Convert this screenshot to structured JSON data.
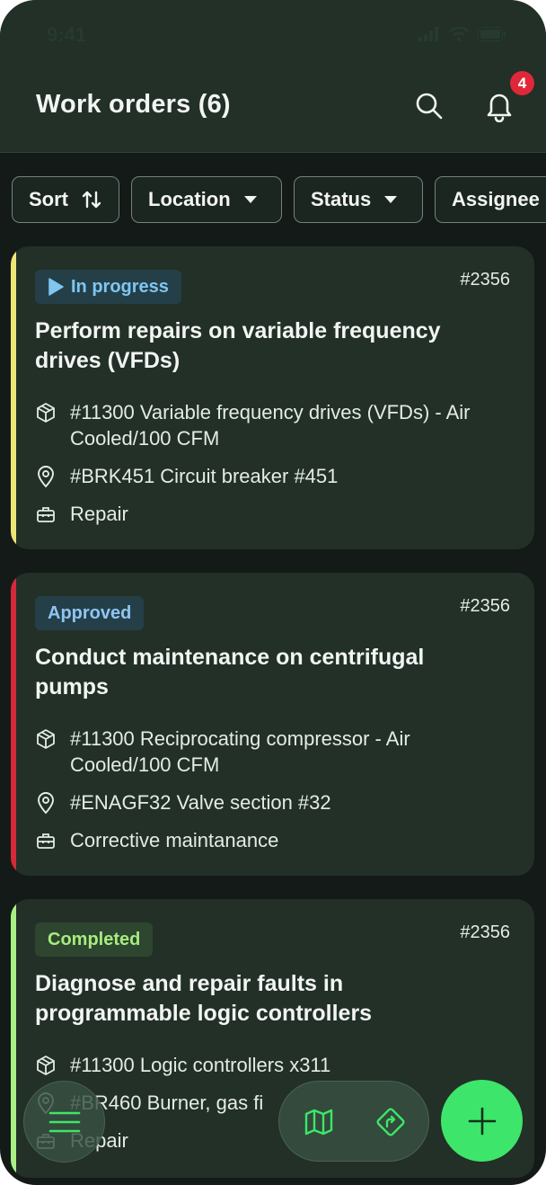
{
  "status_bar": {
    "time": "9:41"
  },
  "header": {
    "title": "Work orders (6)",
    "notification_count": "4"
  },
  "filters": [
    {
      "label": "Sort",
      "icon": "sort-arrows-icon"
    },
    {
      "label": "Location",
      "icon": "caret-down-icon"
    },
    {
      "label": "Status",
      "icon": "caret-down-icon"
    },
    {
      "label": "Assignee",
      "icon": "caret-down-icon"
    }
  ],
  "orders": [
    {
      "status": "In progress",
      "status_color": "#7fc6f0",
      "status_bg": "#253f49",
      "accent": "#eee577",
      "number": "#2356",
      "title": "Perform repairs on variable frequency drives (VFDs)",
      "asset": "#11300 Variable frequency drives (VFDs) - Air Cooled/100 CFM",
      "location": "#BRK451 Circuit breaker #451",
      "type": "Repair"
    },
    {
      "status": "Approved",
      "status_color": "#8fc5f2",
      "status_bg": "#253f49",
      "accent": "#d42a3a",
      "number": "#2356",
      "title": "Conduct maintenance on centrifugal pumps",
      "asset": "#11300 Reciprocating compressor - Air Cooled/100 CFM",
      "location": "#ENAGF32 Valve section #32",
      "type": "Corrective maintanance"
    },
    {
      "status": "Completed",
      "status_color": "#a6ec7e",
      "status_bg": "#2e4530",
      "accent": "#a9f084",
      "number": "#2356",
      "title": "Diagnose and repair faults in programmable logic controllers",
      "asset": "#11300 Logic controllers x311",
      "location": "#BR460 Burner, gas fi",
      "type": "Repair"
    }
  ],
  "bottom_actions": {
    "menu_icon": "hamburger-menu-icon",
    "map_icon": "map-icon",
    "route_icon": "route-sign-icon",
    "add_icon": "plus-icon"
  }
}
